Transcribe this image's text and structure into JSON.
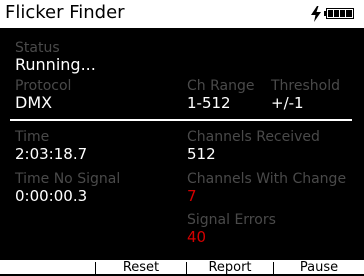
{
  "header": {
    "title": "Flicker Finder",
    "charging_icon": "lightning-bolt-icon",
    "battery_icon": "battery-full-icon"
  },
  "status": {
    "label": "Status",
    "value": "Running..."
  },
  "protocol": {
    "label": "Protocol",
    "value": "DMX"
  },
  "ch_range": {
    "label": "Ch Range",
    "value": "1-512"
  },
  "threshold": {
    "label": "Threshold",
    "value": "+/-1"
  },
  "time": {
    "label": "Time",
    "value": "2:03:18.7"
  },
  "time_no_signal": {
    "label": "Time No Signal",
    "value": "0:00:00.3"
  },
  "channels_received": {
    "label": "Channels Received",
    "value": "512"
  },
  "channels_with_change": {
    "label": "Channels With Change",
    "value": "7"
  },
  "signal_errors": {
    "label": "Signal Errors",
    "value": "40"
  },
  "softkeys": {
    "reset": "Reset",
    "report": "Report",
    "pause": "Pause"
  },
  "colors": {
    "accent_red": "#d40000",
    "label_gray": "#4a4a4a",
    "bar_white": "#ffffff"
  }
}
